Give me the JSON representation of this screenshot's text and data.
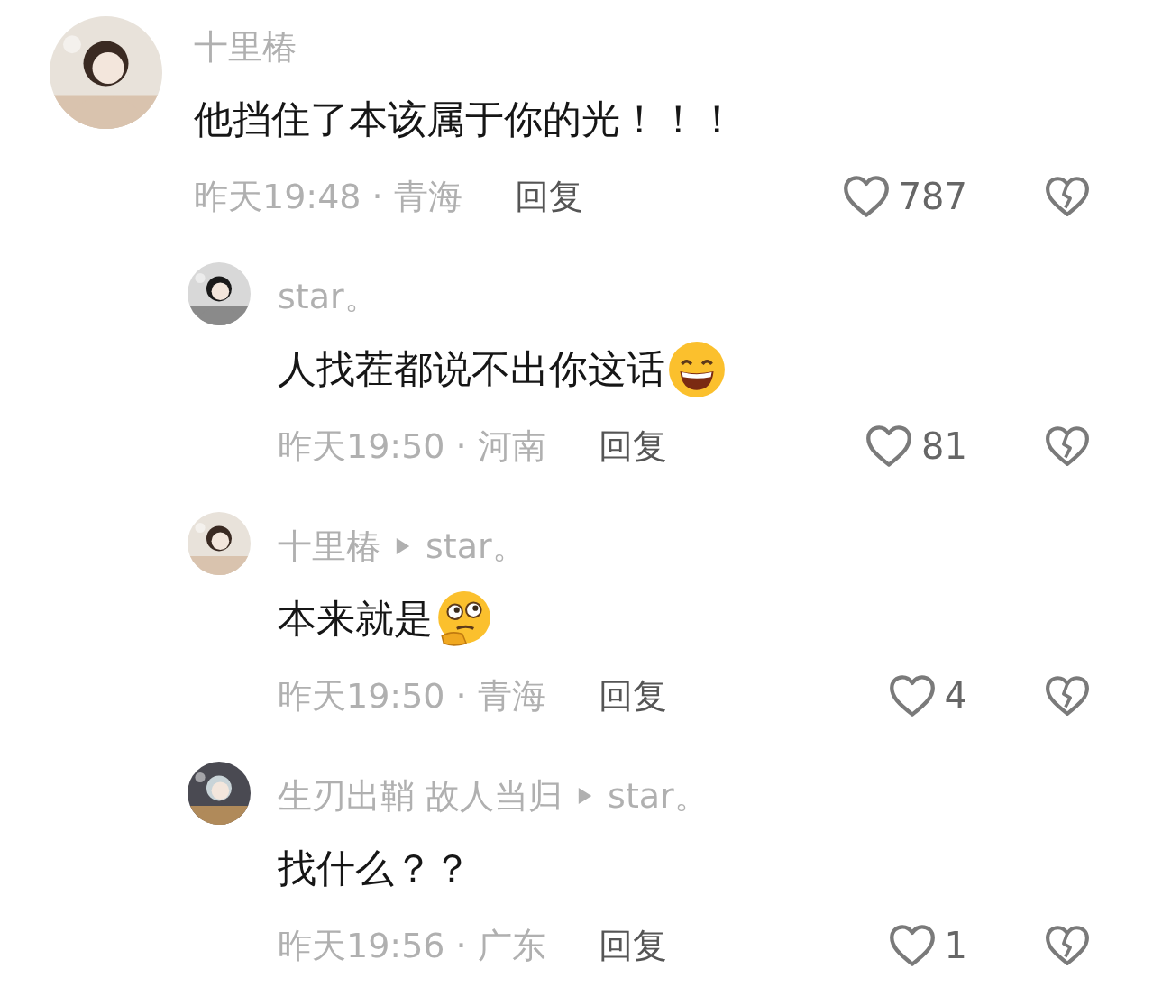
{
  "comments": [
    {
      "kind": "main",
      "author": "十里椿",
      "text": "他挡住了本该属于你的光！！！",
      "time": "昨天19:48 · 青海",
      "reply": "回复",
      "likes": "787"
    },
    {
      "kind": "reply",
      "author": "star。",
      "text": "人找茬都说不出你这话",
      "emoji": {
        "kind": "grin"
      },
      "time": "昨天19:50 · 河南",
      "reply": "回复",
      "likes": "81"
    },
    {
      "kind": "reply",
      "author": "十里椿",
      "reply_to": "star。",
      "text": "本来就是",
      "emoji": {
        "kind": "thinking"
      },
      "time": "昨天19:50 · 青海",
      "reply": "回复",
      "likes": "4"
    },
    {
      "kind": "reply",
      "author": "生刃出鞘  故人当归",
      "reply_to": "star。",
      "text": "找什么？？",
      "time": "昨天19:56 · 广东",
      "reply": "回复",
      "likes": "1"
    }
  ]
}
